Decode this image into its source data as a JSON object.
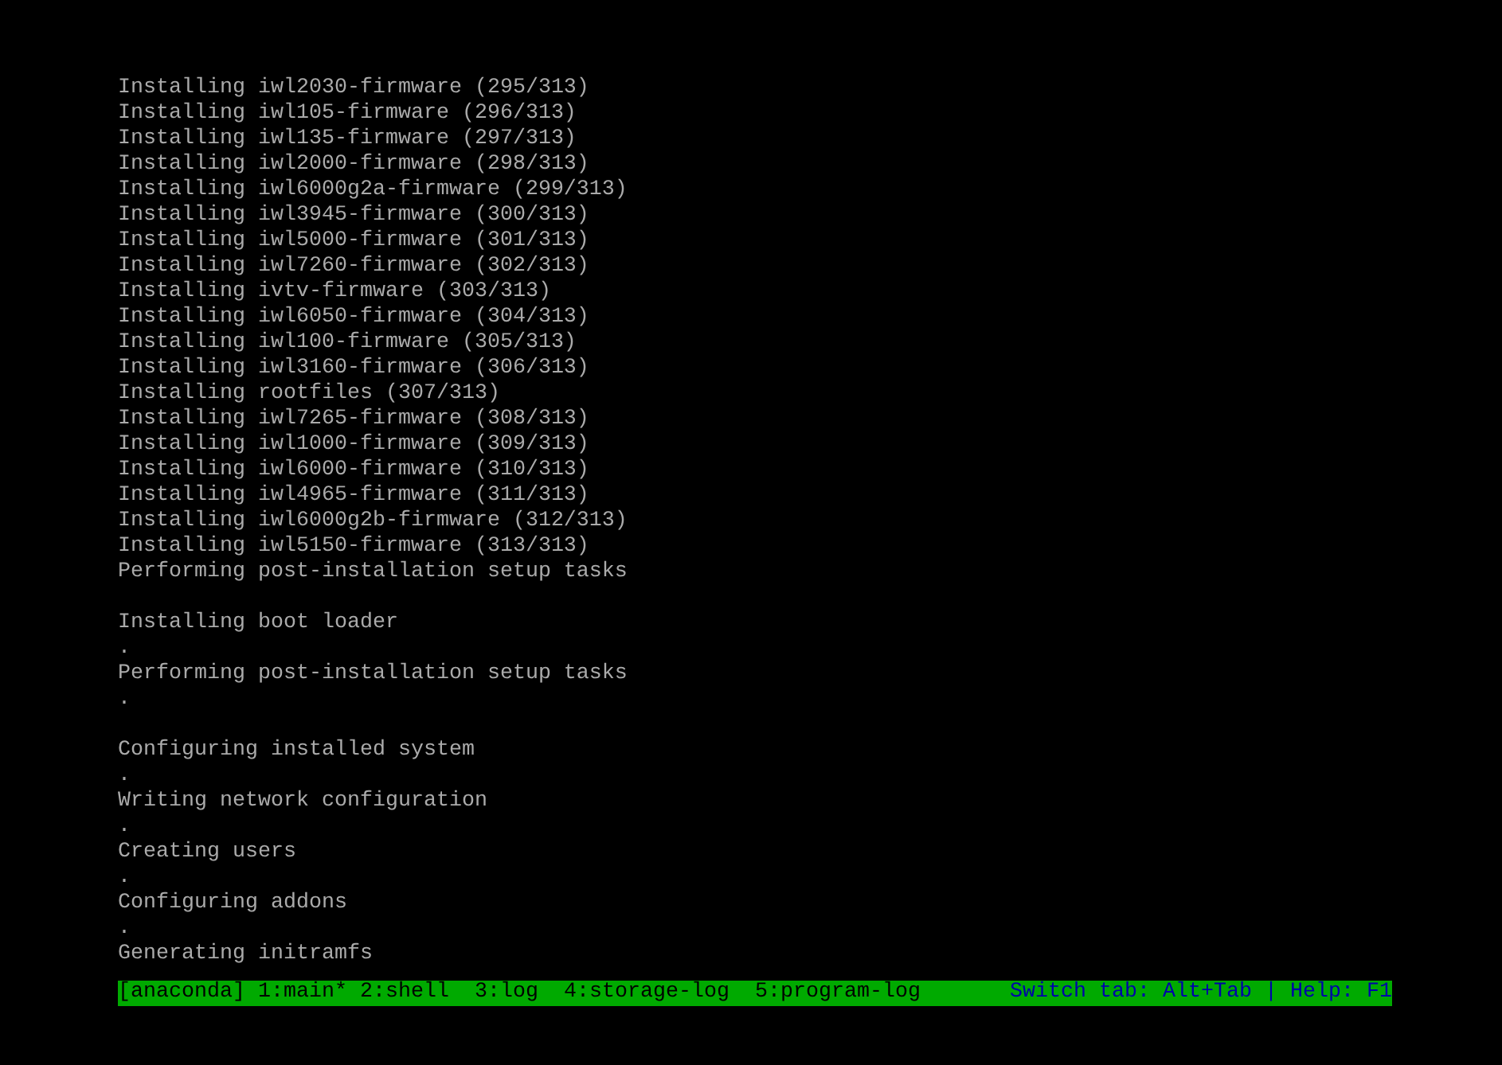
{
  "console_lines": [
    {
      "kind": "text",
      "text": "Installing iwl2030-firmware (295/313)"
    },
    {
      "kind": "text",
      "text": "Installing iwl105-firmware (296/313)"
    },
    {
      "kind": "text",
      "text": "Installing iwl135-firmware (297/313)"
    },
    {
      "kind": "text",
      "text": "Installing iwl2000-firmware (298/313)"
    },
    {
      "kind": "text",
      "text": "Installing iwl6000g2a-firmware (299/313)"
    },
    {
      "kind": "text",
      "text": "Installing iwl3945-firmware (300/313)"
    },
    {
      "kind": "text",
      "text": "Installing iwl5000-firmware (301/313)"
    },
    {
      "kind": "text",
      "text": "Installing iwl7260-firmware (302/313)"
    },
    {
      "kind": "text",
      "text": "Installing ivtv-firmware (303/313)"
    },
    {
      "kind": "text",
      "text": "Installing iwl6050-firmware (304/313)"
    },
    {
      "kind": "text",
      "text": "Installing iwl100-firmware (305/313)"
    },
    {
      "kind": "text",
      "text": "Installing iwl3160-firmware (306/313)"
    },
    {
      "kind": "text",
      "text": "Installing rootfiles (307/313)"
    },
    {
      "kind": "text",
      "text": "Installing iwl7265-firmware (308/313)"
    },
    {
      "kind": "text",
      "text": "Installing iwl1000-firmware (309/313)"
    },
    {
      "kind": "text",
      "text": "Installing iwl6000-firmware (310/313)"
    },
    {
      "kind": "text",
      "text": "Installing iwl4965-firmware (311/313)"
    },
    {
      "kind": "text",
      "text": "Installing iwl6000g2b-firmware (312/313)"
    },
    {
      "kind": "text",
      "text": "Installing iwl5150-firmware (313/313)"
    },
    {
      "kind": "text",
      "text": "Performing post-installation setup tasks"
    },
    {
      "kind": "blank"
    },
    {
      "kind": "text",
      "text": "Installing boot loader"
    },
    {
      "kind": "text",
      "text": "."
    },
    {
      "kind": "text",
      "text": "Performing post-installation setup tasks"
    },
    {
      "kind": "text",
      "text": "."
    },
    {
      "kind": "blank"
    },
    {
      "kind": "text",
      "text": "Configuring installed system"
    },
    {
      "kind": "text",
      "text": "."
    },
    {
      "kind": "text",
      "text": "Writing network configuration"
    },
    {
      "kind": "text",
      "text": "."
    },
    {
      "kind": "text",
      "text": "Creating users"
    },
    {
      "kind": "text",
      "text": "."
    },
    {
      "kind": "text",
      "text": "Configuring addons"
    },
    {
      "kind": "text",
      "text": "."
    },
    {
      "kind": "text",
      "text": "Generating initramfs"
    }
  ],
  "status_bar": {
    "label": "[anaconda]",
    "tabs": [
      "1:main*",
      "2:shell",
      "3:log",
      "4:storage-log",
      "5:program-log"
    ],
    "hint": "Switch tab: Alt+Tab | Help: F1"
  }
}
